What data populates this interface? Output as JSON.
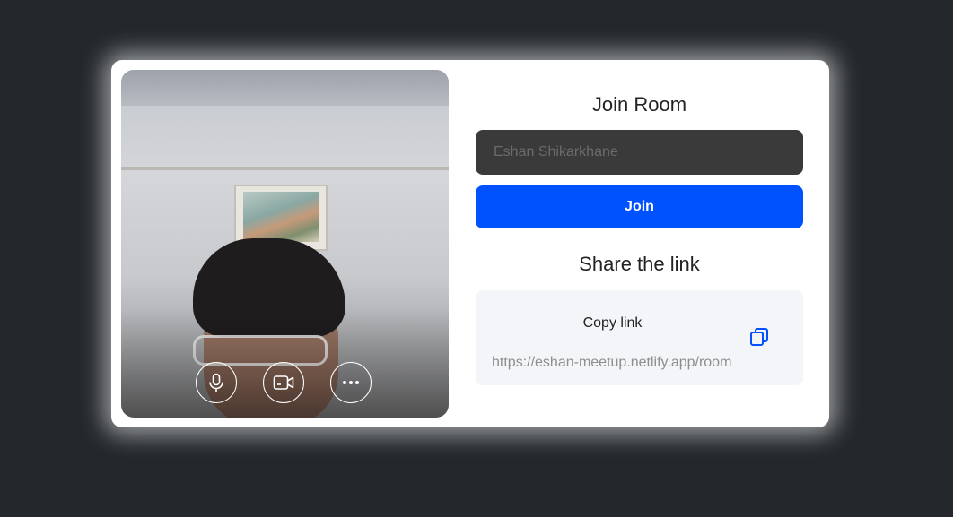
{
  "join": {
    "title": "Join Room",
    "name_value": "Eshan Shikarkhane",
    "join_label": "Join"
  },
  "share": {
    "title": "Share the link",
    "copy_label": "Copy link",
    "url": "https://eshan-meetup.netlify.app/room"
  },
  "controls": {
    "mic_icon": "microphone-icon",
    "camera_icon": "video-camera-icon",
    "more_icon": "more-options-icon",
    "copy_icon": "copy-icon"
  },
  "colors": {
    "accent": "#0052ff",
    "background": "#24282c",
    "input_bg": "#3a3a3a"
  }
}
